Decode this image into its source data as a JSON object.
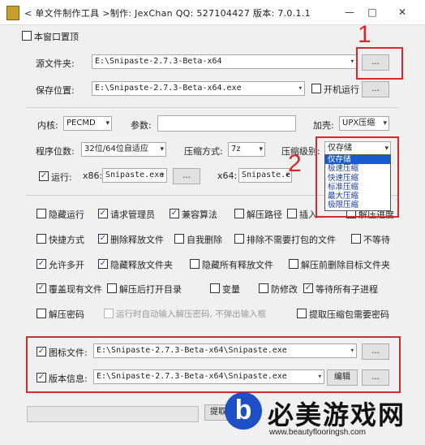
{
  "window": {
    "title": "< 单文件制作工具 >制作: JexChan  QQ: 527104427  版本: 7.0.1.1",
    "minimize": "—",
    "maximize": "□",
    "close": "✕"
  },
  "topmost": {
    "label": "本窗口置顶",
    "checked": false
  },
  "source": {
    "label": "源文件夹:",
    "value": "E:\\Snipaste-2.7.3-Beta-x64",
    "browse": "..."
  },
  "save": {
    "label": "保存位置:",
    "value": "E:\\Snipaste-2.7.3-Beta-x64.exe",
    "startup_label": "开机运行",
    "startup_checked": false,
    "browse": "..."
  },
  "kernel": {
    "label": "内核:",
    "value": "PECMD"
  },
  "params": {
    "label": "参数:",
    "value": ""
  },
  "shell": {
    "label": "加壳:",
    "value": "UPX压缩"
  },
  "bits": {
    "label": "程序位数:",
    "value": "32位/64位自适应"
  },
  "compress_method": {
    "label": "压缩方式:",
    "value": "7z"
  },
  "compress_level": {
    "label": "压缩级别:",
    "value": "仅存储",
    "options": [
      "仅存储",
      "极速压缩",
      "快速压缩",
      "标准压缩",
      "最大压缩",
      "极限压缩"
    ],
    "selected_index": 0
  },
  "run": {
    "label": "运行:",
    "checked": true,
    "x86_label": "x86:",
    "x86_value": "Snipaste.exe",
    "x64_label": "x64:",
    "x64_value": "Snipaste.exe",
    "browse": "..."
  },
  "options": [
    {
      "label": "隐藏运行",
      "checked": false
    },
    {
      "label": "请求管理员",
      "checked": true
    },
    {
      "label": "兼容算法",
      "checked": true
    },
    {
      "label": "解压路径",
      "checked": false
    },
    {
      "label": "插入",
      "checked": false
    },
    {
      "label": "解压进度",
      "checked": false
    },
    {
      "label": "快捷方式",
      "checked": false
    },
    {
      "label": "删除释放文件",
      "checked": true
    },
    {
      "label": "自我删除",
      "checked": false
    },
    {
      "label": "排除不需要打包的文件",
      "checked": false
    },
    {
      "label": "不等待",
      "checked": false
    },
    {
      "label": "允许多开",
      "checked": true
    },
    {
      "label": "隐藏释放文件夹",
      "checked": true
    },
    {
      "label": "隐藏所有释放文件",
      "checked": false
    },
    {
      "label": "解压前删除目标文件夹",
      "checked": false
    },
    {
      "label": "覆盖现有文件",
      "checked": true
    },
    {
      "label": "解压后打开目录",
      "checked": false
    },
    {
      "label": "变量",
      "checked": false
    },
    {
      "label": "防修改",
      "checked": false
    },
    {
      "label": "等待所有子进程",
      "checked": true
    },
    {
      "label": "解压密码",
      "checked": false
    },
    {
      "label": "运行时自动输入解压密码, 不弹出输入框",
      "checked": false
    },
    {
      "label": "提取压缩包需要密码",
      "checked": false
    }
  ],
  "icon_file": {
    "label": "图标文件:",
    "checked": true,
    "value": "E:\\Snipaste-2.7.3-Beta-x64\\Snipaste.exe",
    "browse": "..."
  },
  "version_info": {
    "label": "版本信息:",
    "checked": true,
    "value": "E:\\Snipaste-2.7.3-Beta-x64\\Snipaste.exe",
    "edit": "编辑",
    "browse": "..."
  },
  "bottom": {
    "build_button": "提取"
  },
  "annotations": {
    "one": "1",
    "two": "2"
  },
  "watermark": {
    "logo": "b",
    "title": "必美游戏网",
    "url": "www.beautyflooringsh.com"
  },
  "colors": {
    "annotation_red": "#d42a2a",
    "selection_blue": "#1a5bd0",
    "watermark_blue": "#1f4fc4"
  }
}
